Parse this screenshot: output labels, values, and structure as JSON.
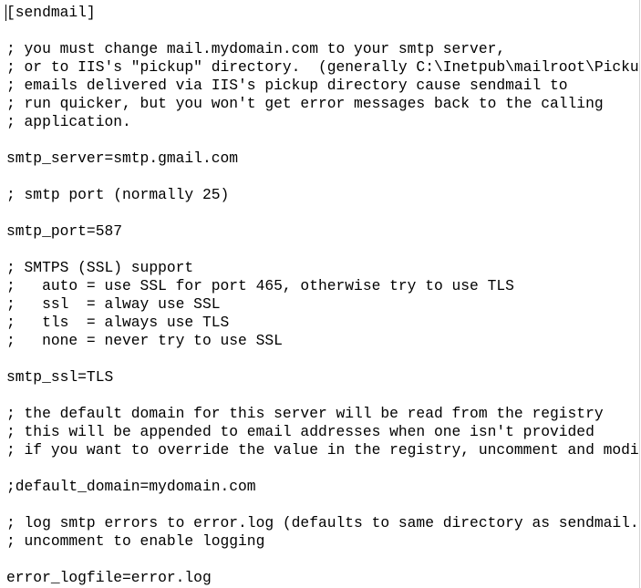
{
  "editor": {
    "lines": [
      "[sendmail]",
      "",
      "; you must change mail.mydomain.com to your smtp server,",
      "; or to IIS's \"pickup\" directory.  (generally C:\\Inetpub\\mailroot\\Pickup)",
      "; emails delivered via IIS's pickup directory cause sendmail to",
      "; run quicker, but you won't get error messages back to the calling",
      "; application.",
      "",
      "smtp_server=smtp.gmail.com",
      "",
      "; smtp port (normally 25)",
      "",
      "smtp_port=587",
      "",
      "; SMTPS (SSL) support",
      ";   auto = use SSL for port 465, otherwise try to use TLS",
      ";   ssl  = alway use SSL",
      ";   tls  = always use TLS",
      ";   none = never try to use SSL",
      "",
      "smtp_ssl=TLS",
      "",
      "; the default domain for this server will be read from the registry",
      "; this will be appended to email addresses when one isn't provided",
      "; if you want to override the value in the registry, uncomment and modify",
      "",
      ";default_domain=mydomain.com",
      "",
      "; log smtp errors to error.log (defaults to same directory as sendmail.exe)",
      "; uncomment to enable logging",
      "",
      "error_logfile=error.log"
    ]
  }
}
